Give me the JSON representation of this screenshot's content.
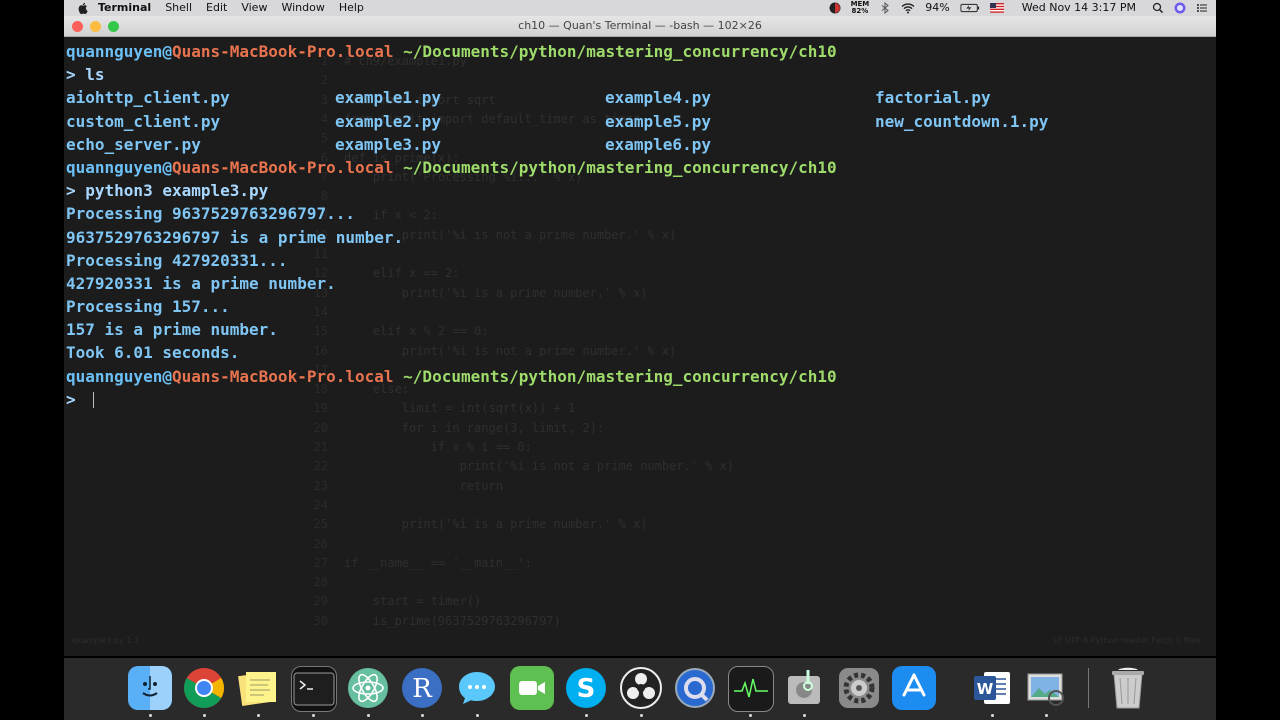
{
  "menubar": {
    "app": "Terminal",
    "items": [
      "Shell",
      "Edit",
      "View",
      "Window",
      "Help"
    ],
    "memory_label": "MEM",
    "memory_value": "82%",
    "battery": "94%",
    "datetime": "Wed Nov 14  3:17 PM"
  },
  "window": {
    "title": "ch10 — Quan's Terminal — -bash — 102×26"
  },
  "terminal": {
    "prompt_user": "quannguyen@",
    "prompt_host": "Quans-MacBook-Pro.local",
    "prompt_path": " ~/Documents/python/mastering_concurrency/ch10",
    "prompt_symbol": "> ",
    "cmd1": "ls",
    "ls_rows": [
      [
        "aiohttp_client.py",
        "example1.py",
        "example4.py",
        "factorial.py"
      ],
      [
        "custom_client.py",
        "example2.py",
        "example5.py",
        "new_countdown.1.py"
      ],
      [
        "echo_server.py",
        "example3.py",
        "example6.py",
        ""
      ]
    ],
    "cmd2": "python3 example3.py",
    "output": [
      "Processing 9637529763296797...",
      "9637529763296797 is a prime number.",
      "Processing 427920331...",
      "427920331 is a prime number.",
      "Processing 157...",
      "157 is a prime number.",
      "Took 6.01 seconds."
    ]
  },
  "ghost_editor": {
    "lines": [
      {
        "n": "1",
        "code": "# ch9/example1.py"
      },
      {
        "n": "2",
        "code": ""
      },
      {
        "n": "3",
        "code": "from math import sqrt"
      },
      {
        "n": "4",
        "code": "from timeit import default_timer as timer"
      },
      {
        "n": "5",
        "code": ""
      },
      {
        "n": "6",
        "code": "def is_prime(x):"
      },
      {
        "n": "7",
        "code": "    print('Processing %i...' % x)"
      },
      {
        "n": "8",
        "code": ""
      },
      {
        "n": "9",
        "code": "    if x < 2:"
      },
      {
        "n": "10",
        "code": "        print('%i is not a prime number.' % x)"
      },
      {
        "n": "11",
        "code": ""
      },
      {
        "n": "12",
        "code": "    elif x == 2:"
      },
      {
        "n": "13",
        "code": "        print('%i is a prime number.' % x)"
      },
      {
        "n": "14",
        "code": ""
      },
      {
        "n": "15",
        "code": "    elif x % 2 == 0:"
      },
      {
        "n": "16",
        "code": "        print('%i is not a prime number.' % x)"
      },
      {
        "n": "17",
        "code": ""
      },
      {
        "n": "18",
        "code": "    else:"
      },
      {
        "n": "19",
        "code": "        limit = int(sqrt(x)) + 1"
      },
      {
        "n": "20",
        "code": "        for i in range(3, limit, 2):"
      },
      {
        "n": "21",
        "code": "            if x % i == 0:"
      },
      {
        "n": "22",
        "code": "                print('%i is not a prime number.' % x)"
      },
      {
        "n": "23",
        "code": "                return"
      },
      {
        "n": "24",
        "code": ""
      },
      {
        "n": "25",
        "code": "        print('%i is a prime number.' % x)"
      },
      {
        "n": "26",
        "code": ""
      },
      {
        "n": "27",
        "code": "if __name__ == '__main__':"
      },
      {
        "n": "28",
        "code": ""
      },
      {
        "n": "29",
        "code": "    start = timer()"
      },
      {
        "n": "30",
        "code": "    is_prime(9637529763296797)"
      }
    ],
    "status_left": "example3.py  1:1",
    "status_right": "LF  UTF-8  Python  master  Fetch  0 files"
  },
  "dock": {
    "apps": [
      "Finder",
      "Chrome",
      "Stickies",
      "Terminal",
      "Atom",
      "R",
      "Messages",
      "FaceTime",
      "Skype",
      "OBS",
      "QuickTime",
      "Activity Monitor",
      "Disk Utility",
      "System Preferences",
      "App Store",
      "Word",
      "Preview",
      "Trash"
    ]
  },
  "colors": {
    "prompt_user": "#6cc0f5",
    "prompt_host": "#e8734f",
    "prompt_path": "#9edb6a",
    "output_text": "#7fc6f5"
  }
}
